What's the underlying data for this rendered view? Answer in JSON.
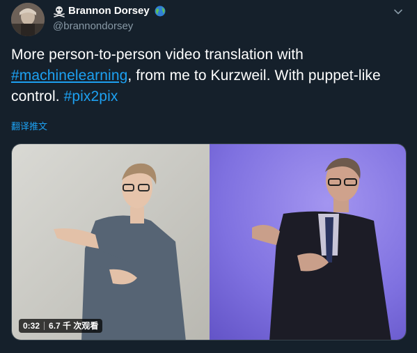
{
  "author": {
    "display_name": "Brannon Dorsey",
    "handle": "@brannondorsey"
  },
  "tweet": {
    "text_before": "More person-to-person video translation with ",
    "hashtag_1": "#machinelearning",
    "text_middle": ", from me to Kurzweil. With puppet-like control. ",
    "hashtag_2": "#pix2pix"
  },
  "translate_label": "翻译推文",
  "media": {
    "duration": "0:32",
    "views": "6.7 千 次观看"
  },
  "colors": {
    "background": "#15202b",
    "link": "#1da1f2",
    "secondary_text": "#8899a6"
  },
  "icons": {
    "skull": "skull-crossbones-icon",
    "globe": "globe-icon",
    "chevron": "chevron-down-icon"
  }
}
